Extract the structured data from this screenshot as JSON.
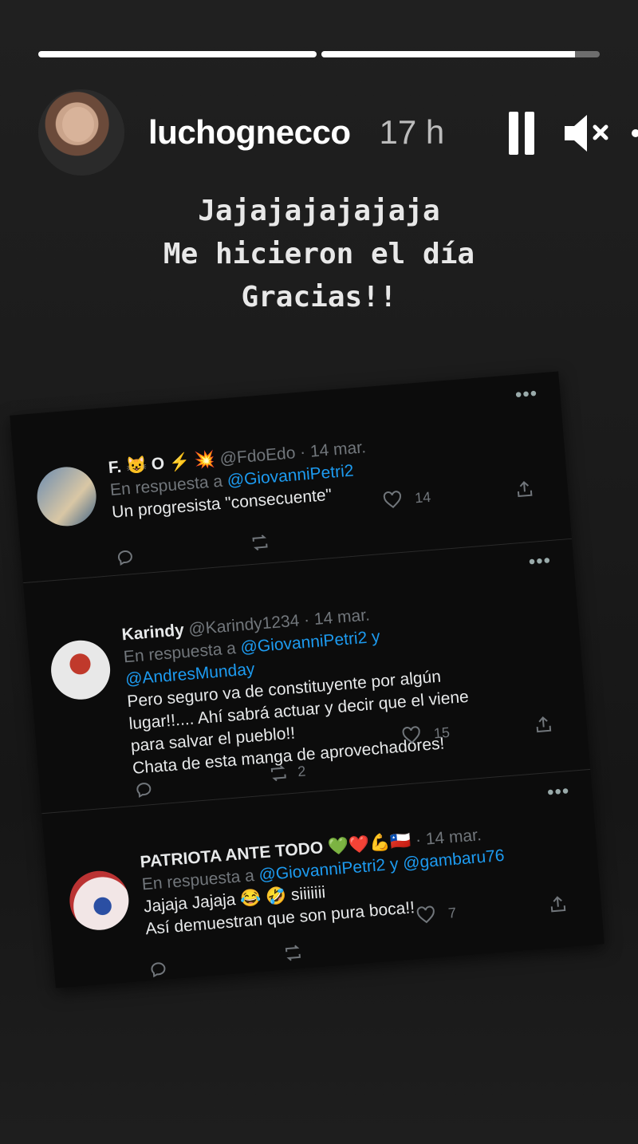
{
  "story": {
    "progress": [
      1.0,
      0.91
    ],
    "username": "luchognecco",
    "time": "17 h",
    "caption_lines": [
      "Jajajajajajaja",
      "Me hicieron el día",
      "Gracias!!"
    ]
  },
  "icons": {
    "pause": "pause-icon",
    "mute": "speaker-muted-icon",
    "more": "more-icon",
    "reply": "reply-icon",
    "retweet": "retweet-icon",
    "like": "heart-icon",
    "share": "share-icon"
  },
  "colors": {
    "link": "#1d9bf0",
    "muted": "#71767b",
    "tweet_bg": "#0c0c0c"
  },
  "tweets": [
    {
      "name": "F. 😺 O ⚡ 💥",
      "handle": "@FdoEdo · 14 mar.",
      "reply_prefix": "En respuesta a",
      "reply_to": "@GiovanniPetri2",
      "text_lines": [
        "Un progresista \"consecuente\""
      ],
      "retweets": "",
      "likes": "14"
    },
    {
      "name": "Karindy",
      "handle": "@Karindy1234 · 14 mar.",
      "reply_prefix": "En respuesta a",
      "reply_to": "@GiovanniPetri2 y",
      "reply_to_2": "@AndresMunday",
      "text_lines": [
        "Pero seguro va de constituyente por algún",
        "lugar!!.... Ahí sabrá actuar y decir que el viene",
        "para salvar el pueblo!!",
        "Chata de esta manga de aprovechadores!"
      ],
      "retweets": "2",
      "likes": "15"
    },
    {
      "name": "PATRIOTA ANTE TODO 💚❤️💪🇨🇱",
      "handle": "· 14 mar.",
      "reply_prefix": "En respuesta a",
      "reply_to": "@GiovanniPetri2 y @gambaru76",
      "text_lines": [
        "Jajaja Jajaja 😂 🤣 siiiiiii",
        "Así demuestran que son pura boca!!"
      ],
      "retweets": "",
      "likes": "7"
    }
  ]
}
